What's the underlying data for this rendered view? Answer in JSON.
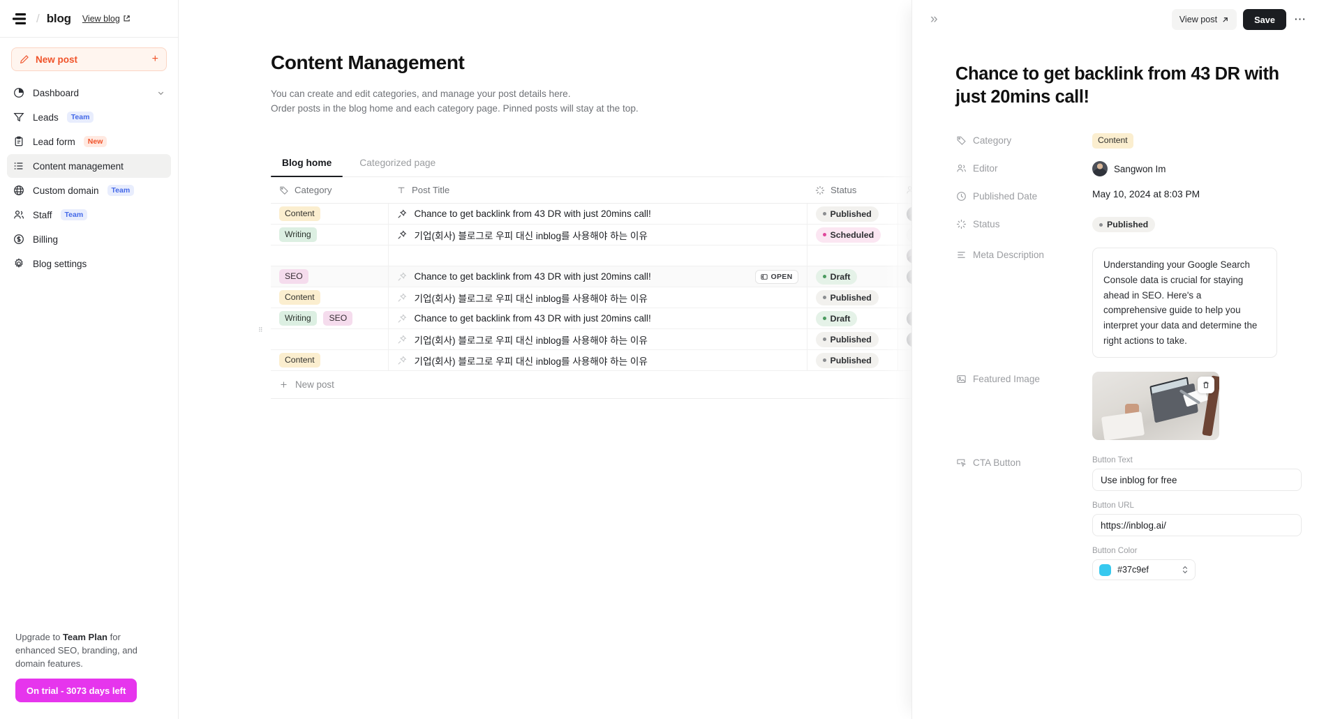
{
  "topbar": {
    "logo_icon": "hamburger-logo-icon",
    "separator": "/",
    "blog_name": "blog",
    "view_blog_label": "View blog",
    "external_link_icon": "external-link-icon"
  },
  "sidebar": {
    "new_post_label": "New post",
    "new_post_plus": "+",
    "items": [
      {
        "label": "Dashboard",
        "icon": "pie-chart-icon",
        "badge": "",
        "chevron": true,
        "active": false
      },
      {
        "label": "Leads",
        "icon": "funnel-icon",
        "badge": "Team",
        "chevron": false,
        "active": false
      },
      {
        "label": "Lead form",
        "icon": "clipboard-icon",
        "badge": "New",
        "chevron": false,
        "active": false
      },
      {
        "label": "Content management",
        "icon": "list-icon",
        "badge": "",
        "chevron": false,
        "active": true
      },
      {
        "label": "Custom domain",
        "icon": "globe-icon",
        "badge": "Team",
        "chevron": false,
        "active": false
      },
      {
        "label": "Staff",
        "icon": "users-icon",
        "badge": "Team",
        "chevron": false,
        "active": false
      },
      {
        "label": "Billing",
        "icon": "dollar-icon",
        "badge": "",
        "chevron": false,
        "active": false
      },
      {
        "label": "Blog settings",
        "icon": "gear-icon",
        "badge": "",
        "chevron": false,
        "active": false
      }
    ],
    "upgrade": {
      "text_before": "Upgrade to ",
      "plan_name": "Team Plan",
      "text_after": " for enhanced SEO, branding, and domain features.",
      "trial_button": "On trial - 3073 days left",
      "trial_button_color": "#e635ed"
    }
  },
  "main": {
    "page_title": "Content Management",
    "subtitle_line1": "You can create and edit categories, and manage your post details here.",
    "subtitle_line2": "Order posts in the blog home and each category page. Pinned posts will stay at the top.",
    "tabs": [
      {
        "label": "Blog home",
        "active": true
      },
      {
        "label": "Categorized page",
        "active": false
      }
    ],
    "search_icon": "search-icon",
    "table": {
      "columns": [
        {
          "label": "Category",
          "icon": "tag-icon"
        },
        {
          "label": "Post Title",
          "icon": "text-type-icon"
        },
        {
          "label": "Status",
          "icon": "status-spinner-icon"
        },
        {
          "label": "",
          "icon": "users-icon"
        }
      ],
      "rows": [
        {
          "categories": [
            "Content"
          ],
          "title": "Chance to get backlink from 43 DR with just 20mins call!",
          "pinned": true,
          "status": "Published",
          "status_kind": "published",
          "author": "avatar",
          "open_pill": "",
          "active": false
        },
        {
          "categories": [
            "Writing"
          ],
          "title": "기업(회사) 블로그로 우피 대신 inblog를 사용해야 하는 이유",
          "pinned": true,
          "status": "Scheduled",
          "status_kind": "scheduled",
          "author": "avatar-ghost",
          "open_pill": "",
          "active": false
        },
        {
          "categories": [],
          "title": "",
          "pinned": false,
          "status": "",
          "status_kind": "",
          "author": "avatar-v2",
          "open_pill": "",
          "active": false
        },
        {
          "categories": [
            "SEO"
          ],
          "title": "Chance to get backlink from 43 DR with just 20mins call!",
          "pinned": false,
          "status": "Draft",
          "status_kind": "draft",
          "author": "avatar",
          "open_pill": "OPEN",
          "active": true
        },
        {
          "categories": [
            "Content"
          ],
          "title": "기업(회사) 블로그로 우피 대신 inblog를 사용해야 하는 이유",
          "pinned": false,
          "status": "Published",
          "status_kind": "published",
          "author": "",
          "open_pill": "",
          "active": false
        },
        {
          "categories": [
            "Writing",
            "SEO"
          ],
          "title": "Chance to get backlink from 43 DR with just 20mins call!",
          "pinned": false,
          "status": "Draft",
          "status_kind": "draft",
          "author": "avatar",
          "open_pill": "",
          "active": false
        },
        {
          "categories": [],
          "title": "기업(회사) 블로그로 우피 대신 inblog를 사용해야 하는 이유",
          "pinned": false,
          "status": "Published",
          "status_kind": "published",
          "author": "avatar",
          "open_pill": "",
          "active": false
        },
        {
          "categories": [
            "Content"
          ],
          "title": "기업(회사) 블로그로 우피 대신 inblog를 사용해야 하는 이유",
          "pinned": false,
          "status": "Published",
          "status_kind": "published",
          "author": "",
          "open_pill": "",
          "active": false
        }
      ],
      "new_post_row": "New post",
      "drag_handle_icon": "drag-handle-icon"
    }
  },
  "panel": {
    "collapse_icon": "chevron-double-right-icon",
    "view_post_label": "View post",
    "view_post_icon": "arrow-up-right-icon",
    "save_label": "Save",
    "more_icon": "ellipsis-icon",
    "title": "Chance to get backlink from 43 DR with just 20mins call!",
    "properties": {
      "category_label": "Category",
      "category_icon": "tag-icon",
      "category_value": "Content",
      "editor_label": "Editor",
      "editor_icon": "users-icon",
      "editor_value": "Sangwon Im",
      "published_date_label": "Published Date",
      "published_date_icon": "clock-icon",
      "published_date_value": "May 10, 2024 at 8:03 PM",
      "status_label": "Status",
      "status_icon": "status-spinner-icon",
      "status_value": "Published",
      "meta_description_label": "Meta Description",
      "meta_description_icon": "align-left-icon",
      "meta_description_value": "Understanding your Google Search Console data is crucial for staying ahead in SEO. Here's a comprehensive guide to help you interpret your data and determine the right actions to take.",
      "featured_image_label": "Featured Image",
      "featured_image_icon": "image-icon",
      "featured_image_delete_icon": "trash-icon",
      "cta_button_label": "CTA Button",
      "cta_button_icon": "cursor-click-icon",
      "button_text_label": "Button Text",
      "button_text_value": "Use inblog for free",
      "button_url_label": "Button URL",
      "button_url_value": "https://inblog.ai/",
      "button_color_label": "Button Color",
      "button_color_value": "#37c9ef",
      "button_color_stepper_icon": "up-down-chevron-icon"
    }
  }
}
